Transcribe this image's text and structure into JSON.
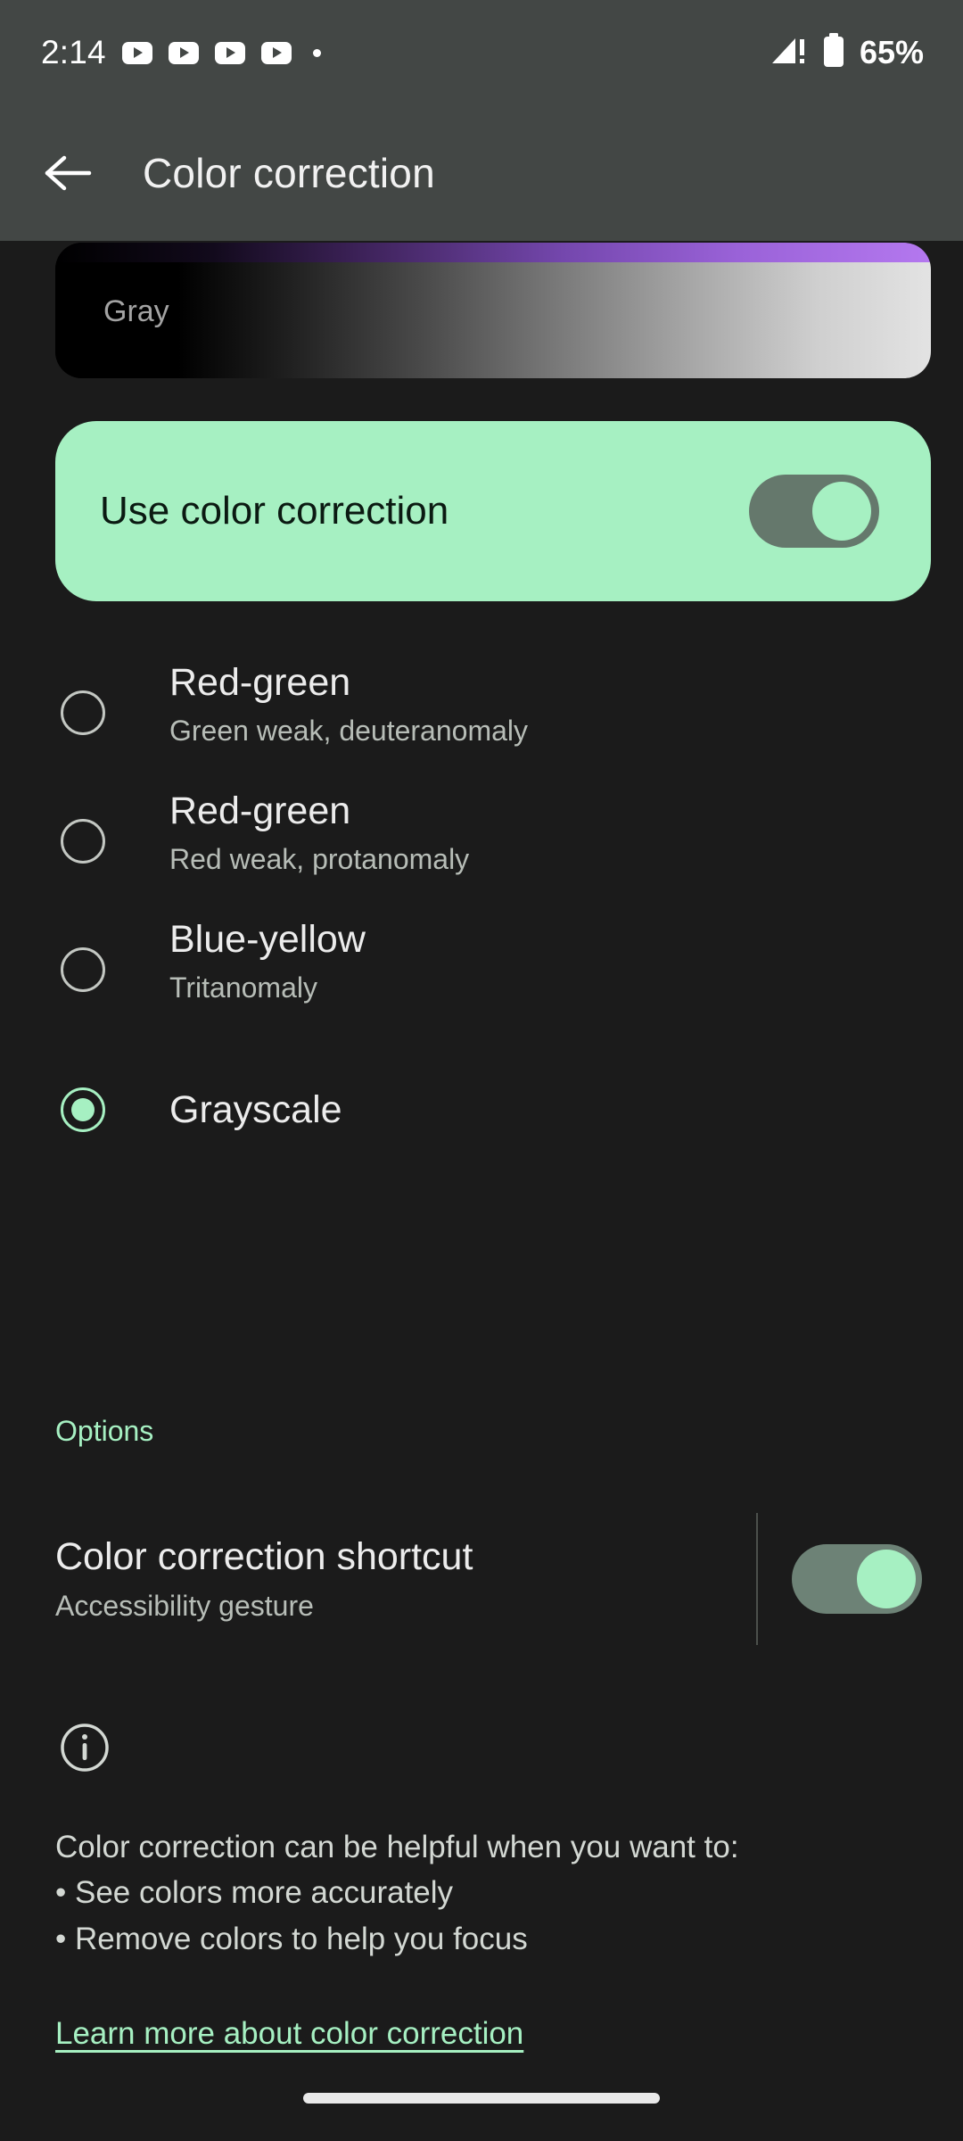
{
  "status_bar": {
    "time": "2:14",
    "notification_icons": [
      "youtube-icon",
      "youtube-icon",
      "youtube-icon",
      "youtube-icon",
      "overflow-dot"
    ],
    "signal_icon": "cellular-signal-alert-icon",
    "battery_icon": "battery-icon",
    "battery_percent": "65%"
  },
  "app_bar": {
    "back_icon": "back-arrow-icon",
    "title": "Color correction"
  },
  "preview": {
    "label": "Gray"
  },
  "main_toggle": {
    "label": "Use color correction",
    "state": "on"
  },
  "correction_modes": [
    {
      "title": "Red-green",
      "subtitle": "Green weak, deuteranomaly",
      "selected": false
    },
    {
      "title": "Red-green",
      "subtitle": "Red weak, protanomaly",
      "selected": false
    },
    {
      "title": "Blue-yellow",
      "subtitle": "Tritanomaly",
      "selected": false
    },
    {
      "title": "Grayscale",
      "subtitle": "",
      "selected": true
    }
  ],
  "options": {
    "header": "Options",
    "shortcut": {
      "title": "Color correction shortcut",
      "subtitle": "Accessibility gesture",
      "state": "on"
    }
  },
  "info": {
    "icon": "info-icon",
    "lines": [
      "Color correction can be helpful when you want to:",
      "• See colors more accurately",
      "• Remove colors to help you focus"
    ],
    "link": "Learn more about color correction"
  },
  "colors": {
    "accent": "#a6f0c2",
    "page_background": "#1b1b1b",
    "bar_background": "#434745",
    "card_background": "#a6f0c2",
    "switch_track": "#65786c",
    "secondary_text": "#b7bdb7"
  },
  "nav": {
    "pill": "home-gesture-pill"
  }
}
